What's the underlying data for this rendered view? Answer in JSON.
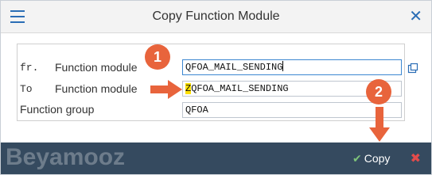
{
  "dialog": {
    "title": "Copy Function Module"
  },
  "form": {
    "from_code": "fr.",
    "from_label": "Function module",
    "from_value": "QFOA_MAIL_SENDING",
    "to_code": "To",
    "to_label": "Function module",
    "to_value_prefix": "Z",
    "to_value_rest": "QFOA_MAIL_SENDING",
    "group_label": "Function group",
    "group_value": "QFOA"
  },
  "footer": {
    "copy_label": "Copy",
    "watermark": "Beyamooz"
  },
  "annotations": {
    "step1": "1",
    "step2": "2"
  },
  "colors": {
    "accent": "#2a6db5",
    "footer_bg": "#354a5f",
    "annotation": "#e8643c",
    "highlight": "#ffe000"
  },
  "icons": [
    "menu-icon",
    "close-icon",
    "value-help-icon",
    "check-icon",
    "cancel-icon",
    "arrow-icon"
  ]
}
